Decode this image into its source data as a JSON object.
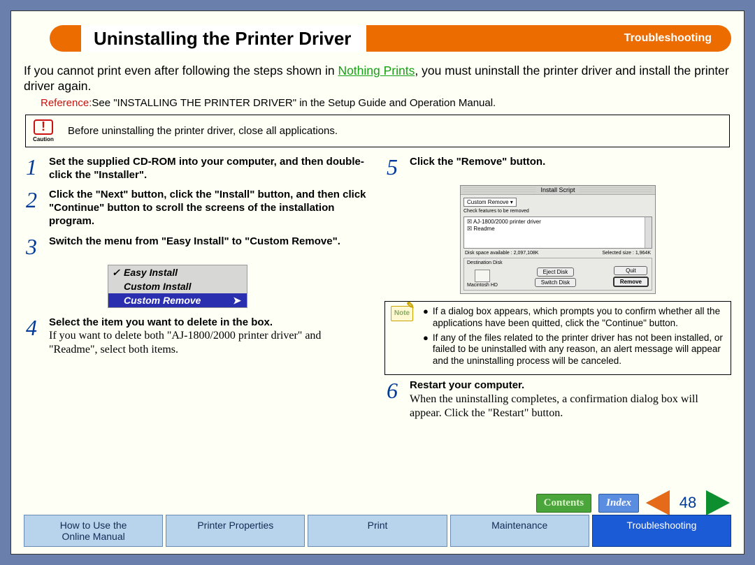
{
  "header": {
    "title": "Uninstalling the Printer Driver",
    "section": "Troubleshooting"
  },
  "intro": {
    "prefix": "If you cannot print even after following the steps shown in ",
    "link": "Nothing Prints",
    "suffix": ", you must uninstall the printer driver and install the printer driver again."
  },
  "reference": {
    "label": "Reference:",
    "text": "See \"INSTALLING THE PRINTER DRIVER\" in the Setup Guide and Operation Manual."
  },
  "caution": {
    "label": "Caution",
    "text": "Before uninstalling the printer driver, close all applications."
  },
  "steps_left": [
    {
      "num": "1",
      "bold": "Set the supplied CD-ROM into your computer, and then double-click the \"Installer\"."
    },
    {
      "num": "2",
      "bold": "Click the \"Next\" button, click the \"Install\" button, and then click \"Continue\" button to scroll the screens of the installation program."
    },
    {
      "num": "3",
      "bold": "Switch the menu from \"Easy Install\" to \"Custom Remove\"."
    },
    {
      "num": "4",
      "bold": "Select the item you want to delete in the box.",
      "plain": "If you want to delete both \"AJ-1800/2000 printer driver\" and \"Readme\", select both items."
    }
  ],
  "install_menu": {
    "items": [
      "Easy Install",
      "Custom Install",
      "Custom Remove"
    ],
    "selected": "Custom Remove"
  },
  "steps_right": [
    {
      "num": "5",
      "bold": "Click the \"Remove\" button."
    },
    {
      "num": "6",
      "bold": "Restart your computer.",
      "plain": "When the uninstalling completes, a confirmation dialog box will appear. Click the \"Restart\" button."
    }
  ],
  "dialog": {
    "title": "Install Script",
    "dropdown": "Custom Remove",
    "check_label": "Check features to be removed",
    "items": [
      "AJ-1800/2000 printer driver",
      "Readme"
    ],
    "disk_avail": "Disk space available : 2,097,108K",
    "sel_size": "Selected size : 1,964K",
    "dest_label": "Destination Disk",
    "disk_name": "Macintosh HD",
    "btn_eject": "Eject Disk",
    "btn_switch": "Switch Disk",
    "btn_quit": "Quit",
    "btn_remove": "Remove"
  },
  "note": {
    "label": "Note",
    "items": [
      "If a dialog box appears, which prompts you to confirm whether all the applications have been quitted, click the \"Continue\" button.",
      "If any of the files related to the printer driver has not been installed, or failed to be uninstalled with any reason, an alert message will appear and the uninstalling process will be canceled."
    ]
  },
  "nav": {
    "contents": "Contents",
    "index": "Index",
    "page": "48"
  },
  "tabs": [
    "How to Use the\nOnline Manual",
    "Printer Properties",
    "Print",
    "Maintenance",
    "Troubleshooting"
  ],
  "active_tab": 4
}
